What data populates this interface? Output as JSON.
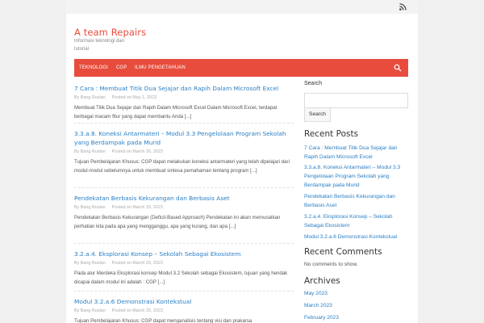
{
  "header": {
    "site_title": "A team Repairs",
    "site_description": "Informasi teknologi dan tutorial",
    "rss_icon": "rss-icon"
  },
  "nav": {
    "items": [
      "TEKNOLOGI",
      "CGP",
      "ILMU PENGETAHUAN"
    ],
    "search_icon": "search-icon"
  },
  "posts": [
    {
      "title": "7 Cara : Membuat Titik Dua Sejajar dan Rapih Dalam Microsoft Excel",
      "author": "By Bang Ruslan",
      "date": "Posted on May 1, 2023",
      "excerpt": "Membuat Titik Dua Sejajar dan Rapih Dalam Microsoft Excel Dalam Microsoft Excel, terdapat berbagai macam fitur yang dapat membantu Anda [...]"
    },
    {
      "title": "3.3.a.8. Koneksi Antarmateri – Modul 3.3 Pengelolaan Program Sekolah yang Berdampak pada Murid",
      "author": "By Bang Ruslan",
      "date": "Posted on March 20, 2023",
      "excerpt": "Tujuan Pembelajaran Khusus: CGP dapat melakukan koneksi antarmateri yang telah dipelajari dari modul-modul sebelumnya untuk membuat sintesa pemahaman tentang program [...]"
    },
    {
      "title": "Pendekatan Berbasis Kekurangan dan Berbasis Aset",
      "author": "By Bang Ruslan",
      "date": "Posted on March 20, 2023",
      "excerpt": "Pendekatan Berbasis Kekurangan (Deficit-Based Approach) Pendekatan ini akan memusatkan perhatian kita pada apa yang mengganggu, apa yang kurang, dan apa [...]"
    },
    {
      "title": "3.2.a.4. Eksplorasi Konsep – Sekolah Sebagai Ekosistem",
      "author": "By Bang Ruslan",
      "date": "Posted on March 20, 2023",
      "excerpt": "Pada alur Merdeka Eksplorasi konsep Modul 3.2 Sekolah sebagai Ekosistem, tujuan yang hendak dicapai dalam modul ini adalah : CGP [...]"
    },
    {
      "title": "Modul 3.2.a.6 Demonstrasi Kontekstual",
      "author": "By Bang Ruslan",
      "date": "Posted on March 20, 2023",
      "excerpt": "Tujuan Pembelajaran Khusus: CGP dapat menganalisis tentang visi dan prakarsa"
    }
  ],
  "sidebar": {
    "search_label": "Search",
    "search_button": "Search",
    "recent_posts_title": "Recent Posts",
    "recent_posts": [
      "7 Cara : Membuat Titik Dua Sejajar dan Rapih Dalam Microsoft Excel",
      "3.3.a.8. Koneksi Antarmateri – Modul 3.3 Pengelolaan Program Sekolah yang Berdampak pada Murid",
      "Pendekatan Berbasis Kekurangan dan Berbasis Aset",
      "3.2.a.4. Eksplorasi Konsep – Sekolah Sebagai Ekosistem",
      "Modul 3.2.a.6 Demonstrasi Kontekstual"
    ],
    "recent_comments_title": "Recent Comments",
    "no_comments": "No comments to show.",
    "archives_title": "Archives",
    "archives": [
      "May 2023",
      "March 2023",
      "February 2023"
    ]
  },
  "colors": {
    "accent": "#e74c3c",
    "link": "#2a7fc5"
  }
}
